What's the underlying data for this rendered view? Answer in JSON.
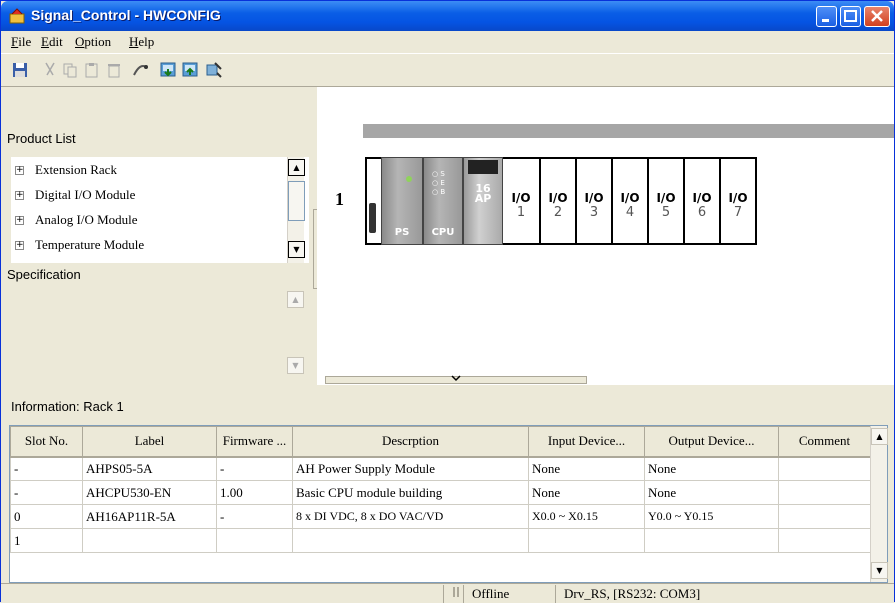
{
  "window": {
    "title": "Signal_Control - HWCONFIG"
  },
  "menu": [
    "File",
    "Edit",
    "Option",
    "Help"
  ],
  "left": {
    "product_list_label": "Product List",
    "tree": [
      "Extension Rack",
      "Digital I/O Module",
      "Analog I/O Module",
      "Temperature Module"
    ],
    "specification_label": "Specification"
  },
  "rack": {
    "number": "1",
    "modules": [
      {
        "label": "PS"
      },
      {
        "label": "CPU"
      },
      {
        "label": "16\nAP"
      }
    ],
    "io_slot_label": "I/O",
    "io_slots": [
      "1",
      "2",
      "3",
      "4",
      "5",
      "6",
      "7"
    ]
  },
  "info": {
    "label": "Information: Rack 1",
    "columns": [
      "Slot No.",
      "Label",
      "Firmware ...",
      "Descrption",
      "Input Device...",
      "Output Device...",
      "Comment"
    ],
    "rows": [
      [
        "-",
        "AHPS05-5A",
        "-",
        "AH Power Supply Module",
        "None",
        "None",
        ""
      ],
      [
        "-",
        "AHCPU530-EN",
        "1.00",
        "Basic CPU module building",
        "None",
        "None",
        ""
      ],
      [
        "0",
        "AH16AP11R-5A",
        "-",
        "8 x DI VDC, 8 x DO VAC/VD",
        "X0.0 ~ X0.15",
        "Y0.0 ~ Y0.15",
        ""
      ],
      [
        "1",
        "",
        "",
        "",
        "",
        "",
        ""
      ]
    ]
  },
  "status": {
    "state": "Offline",
    "driver": "Drv_RS, [RS232: COM3]"
  }
}
